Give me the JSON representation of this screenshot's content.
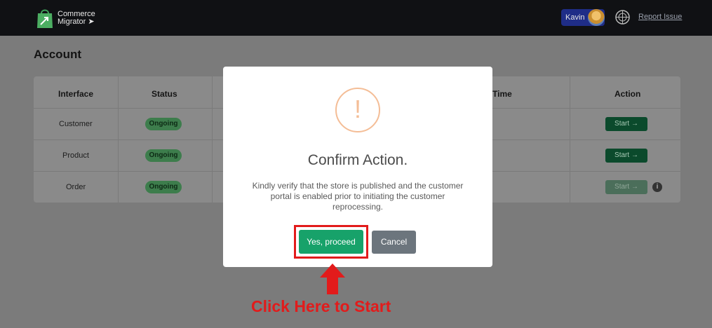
{
  "header": {
    "brand_line1": "Commerce",
    "brand_line2": "Migrator",
    "user_name": "Kavin",
    "report_link": "Report Issue"
  },
  "page": {
    "title": "Account",
    "table": {
      "columns": [
        "Interface",
        "Status",
        "Time",
        "Action"
      ],
      "rows": [
        {
          "interface": "Customer",
          "status": "Ongoing",
          "action": "Start →",
          "action_enabled": true
        },
        {
          "interface": "Product",
          "status": "Ongoing",
          "action": "Start →",
          "action_enabled": true
        },
        {
          "interface": "Order",
          "status": "Ongoing",
          "action": "Start →",
          "action_enabled": false
        }
      ]
    }
  },
  "modal": {
    "icon": "exclamation-circle-icon",
    "title": "Confirm Action.",
    "message": "Kindly verify that the store is published and the customer portal is enabled prior to initiating the customer reprocessing.",
    "confirm_label": "Yes, proceed",
    "cancel_label": "Cancel"
  },
  "overlay": {
    "instruction": "Click Here to Start",
    "arrow_icon": "up-arrow-icon",
    "accent_color": "#e21b1b"
  },
  "colors": {
    "topbar": "#101114",
    "confirm": "#17a26a",
    "cancel": "#6c757d",
    "warning": "#f4bd96"
  }
}
